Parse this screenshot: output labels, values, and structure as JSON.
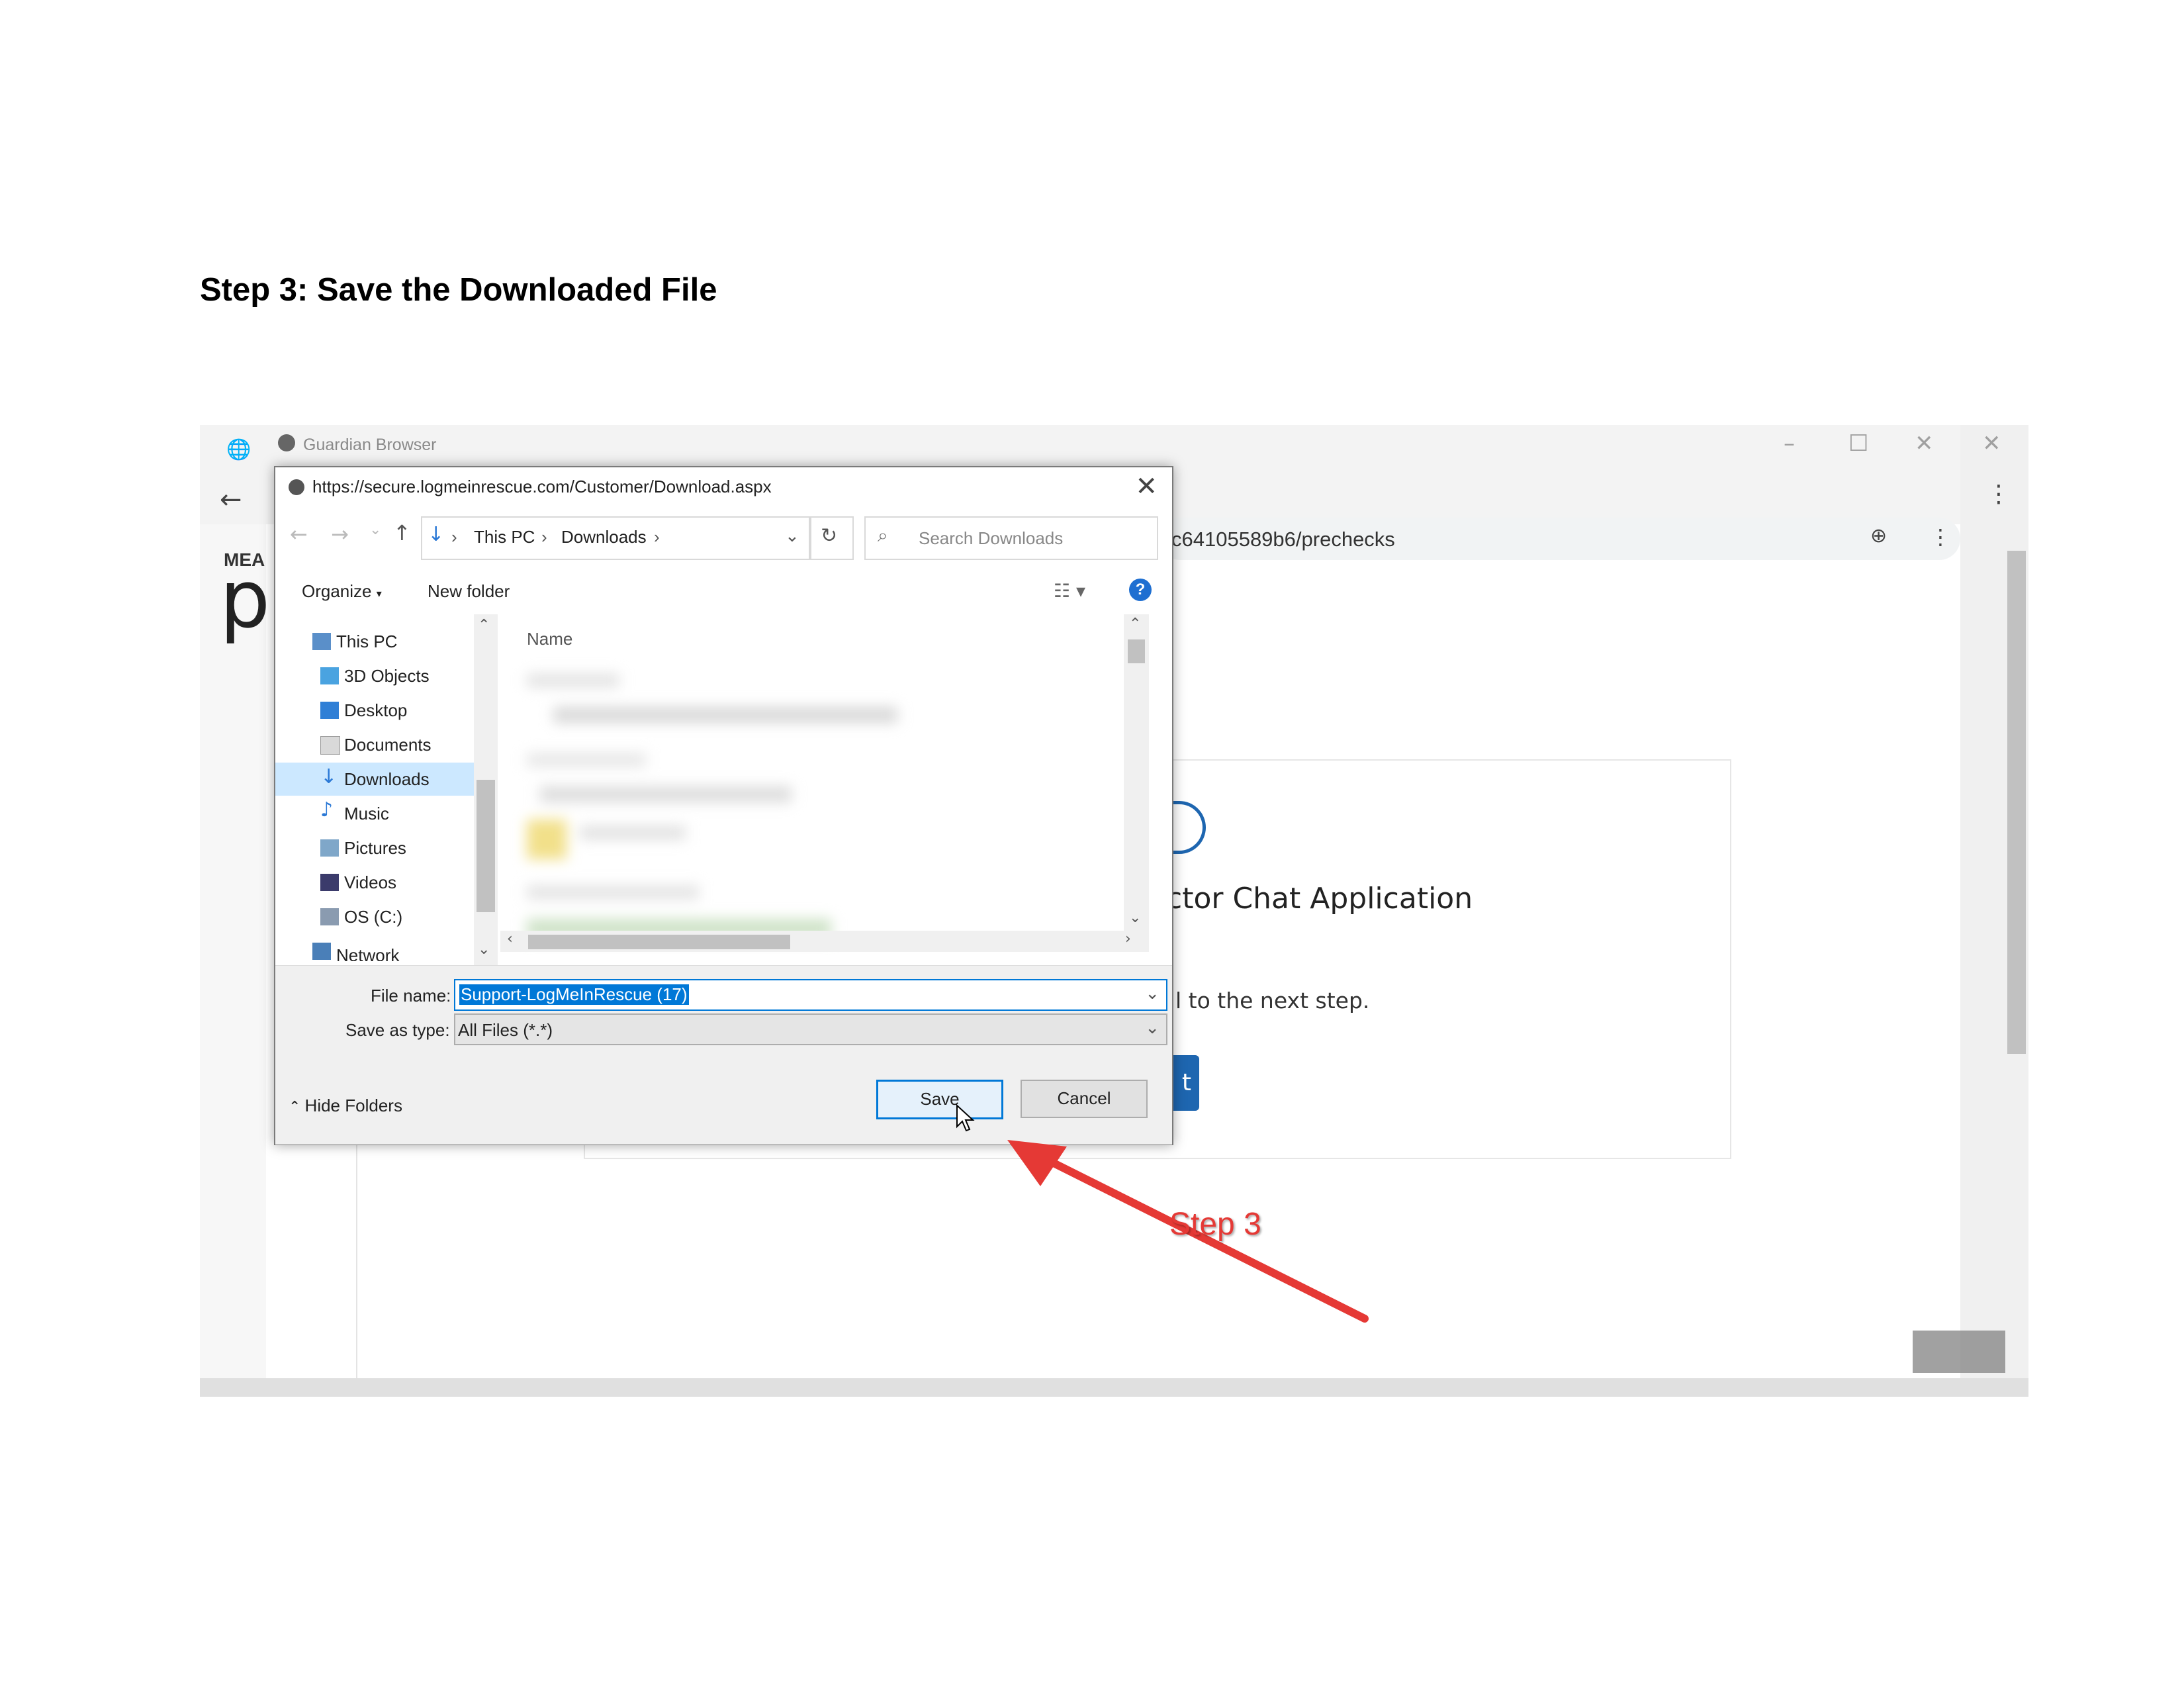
{
  "document": {
    "heading": "Step 3: Save the Downloaded File"
  },
  "background_browser": {
    "window_title": "Guardian Browser",
    "address_fragment": "c64105589b6/prechecks",
    "logo_text": "MEA",
    "logo_letter": "p",
    "card_title_fragment": "ctor Chat Application",
    "card_subtitle_fragment": "l to the next step.",
    "card_button_fragment": "t"
  },
  "dialog": {
    "title_url": "https://secure.logmeinrescue.com/Customer/Download.aspx",
    "breadcrumb": [
      "This PC",
      "Downloads"
    ],
    "search_placeholder": "Search Downloads",
    "toolbar": {
      "organize": "Organize",
      "new_folder": "New folder"
    },
    "column_name": "Name",
    "tree": [
      {
        "label": "This PC",
        "icon": "computer-icon"
      },
      {
        "label": "3D Objects",
        "icon": "cube-icon"
      },
      {
        "label": "Desktop",
        "icon": "desktop-icon"
      },
      {
        "label": "Documents",
        "icon": "document-icon"
      },
      {
        "label": "Downloads",
        "icon": "download-icon",
        "selected": true
      },
      {
        "label": "Music",
        "icon": "music-icon"
      },
      {
        "label": "Pictures",
        "icon": "picture-icon"
      },
      {
        "label": "Videos",
        "icon": "film-icon"
      },
      {
        "label": "OS (C:)",
        "icon": "drive-icon"
      },
      {
        "label": "Network",
        "icon": "network-icon"
      }
    ],
    "file_name_label": "File name:",
    "file_name_value": "Support-LogMeInRescue (17)",
    "save_as_type_label": "Save as type:",
    "save_as_type_value": "All Files (*.*)",
    "hide_folders": "Hide Folders",
    "save_button": "Save",
    "cancel_button": "Cancel"
  },
  "annotation": {
    "label": "Step 3",
    "color": "#e53935"
  }
}
